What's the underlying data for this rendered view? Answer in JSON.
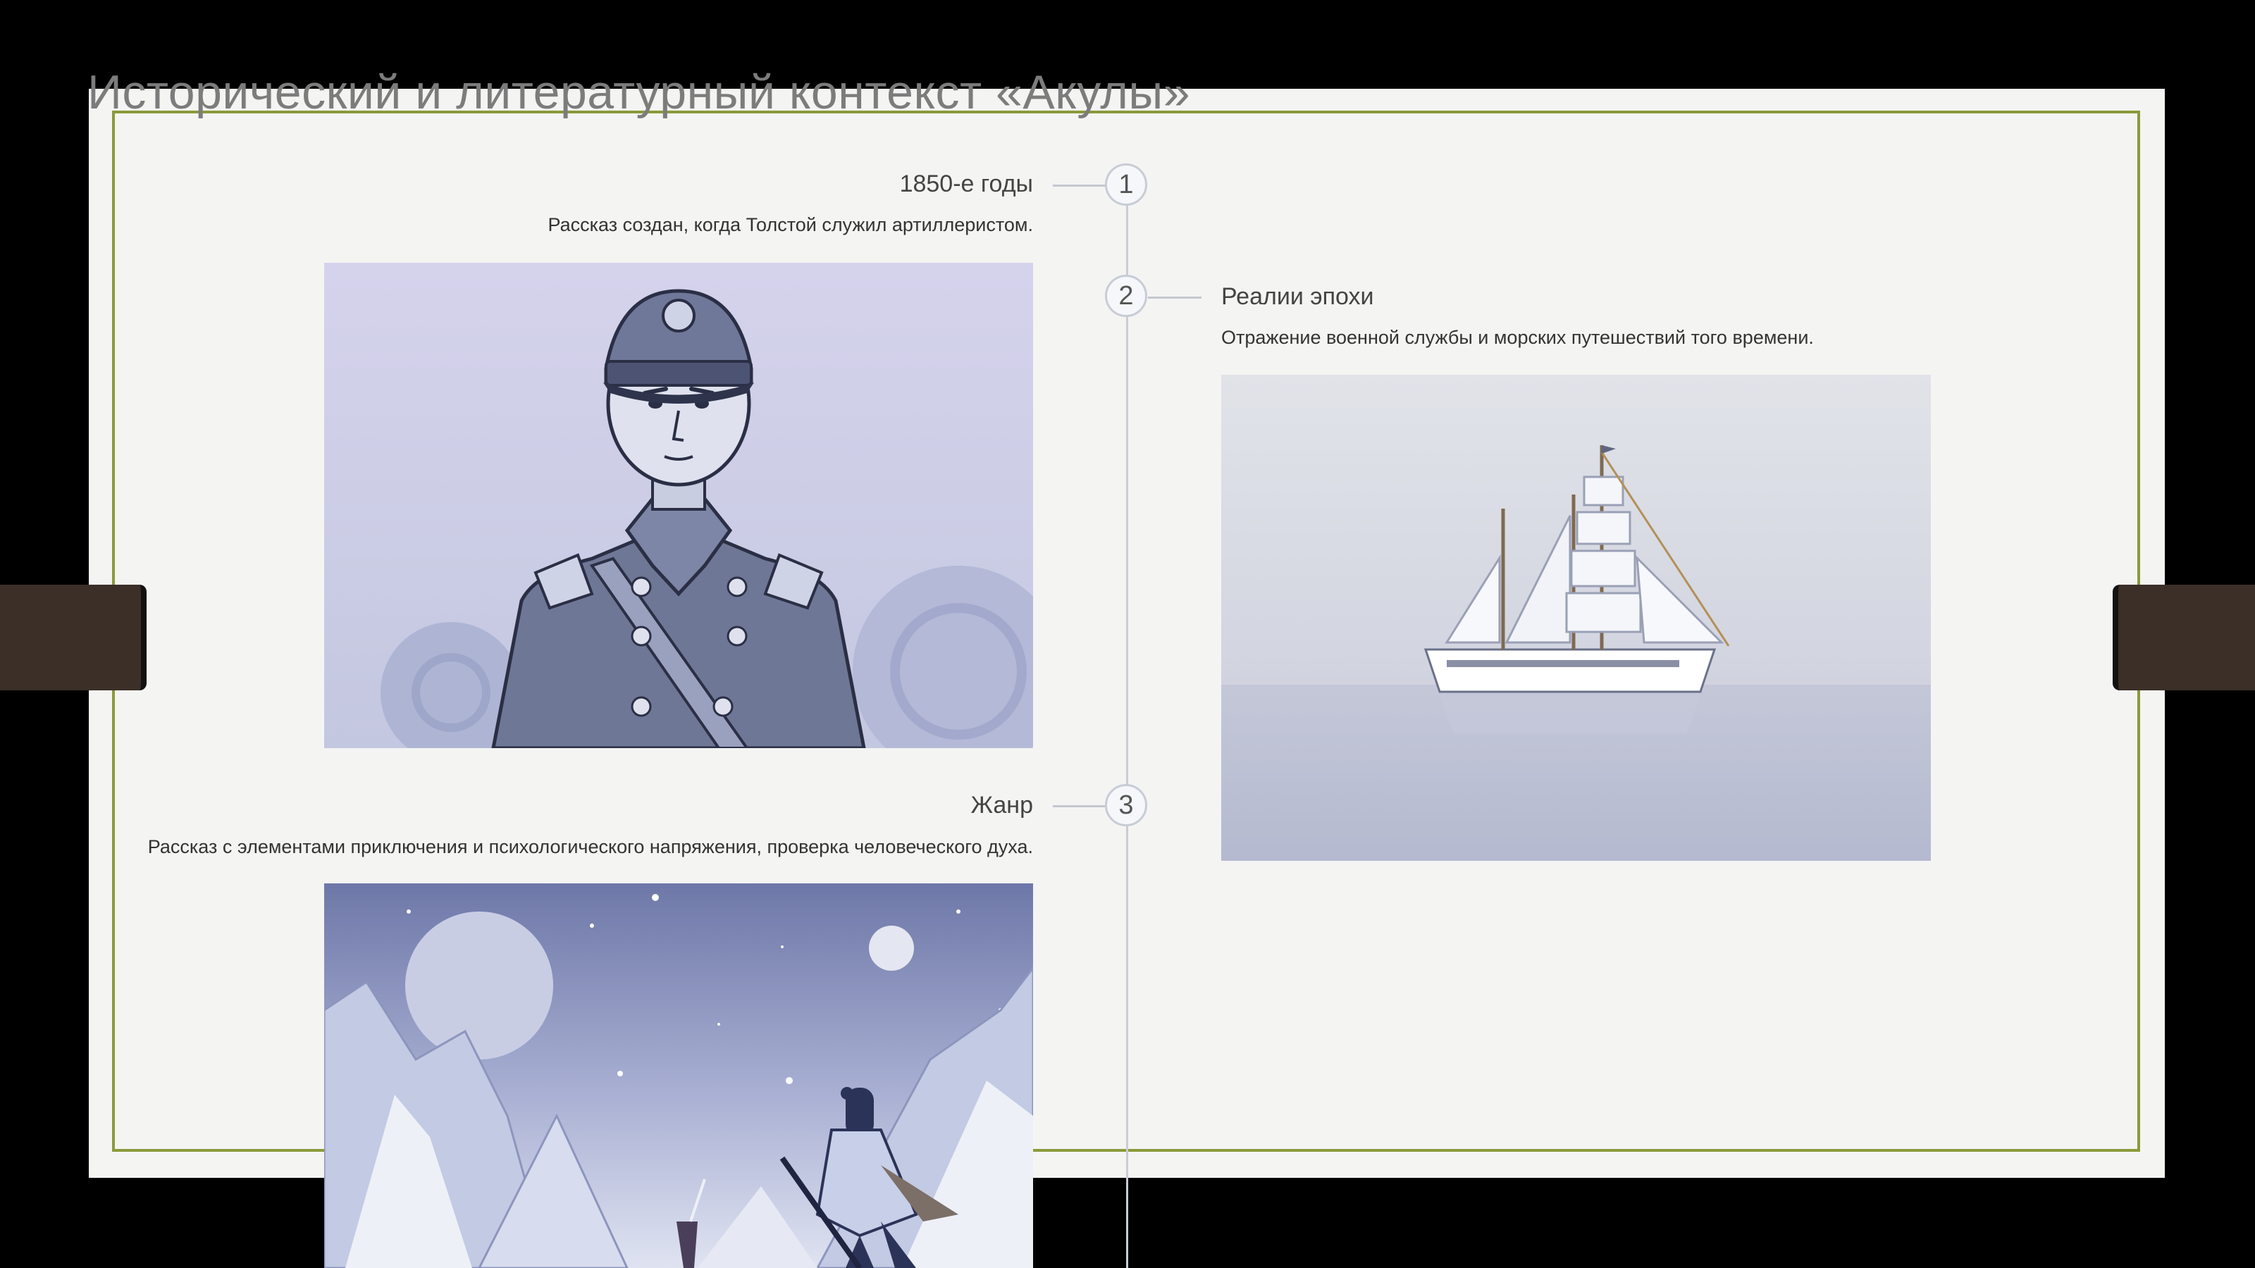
{
  "slide": {
    "title": "Исторический и литературный контекст «Акулы»",
    "events": [
      {
        "number": "1",
        "title": "1850-е годы",
        "description": "Рассказ создан, когда Толстой служил артиллеристом.",
        "image_icon": "officer-illustration"
      },
      {
        "number": "2",
        "title": "Реалии эпохи",
        "description": "Отражение военной службы и морских путешествий того времени.",
        "image_icon": "sailing-ship-illustration"
      },
      {
        "number": "3",
        "title": "Жанр",
        "description": "Рассказ с элементами приключения и психологического напряжения, проверка человеческого духа.",
        "image_icon": "mountain-warrior-illustration"
      }
    ],
    "colors": {
      "frame": "#8a9a3b",
      "background": "#f4f4f3",
      "axis": "#c9ccd3"
    }
  }
}
